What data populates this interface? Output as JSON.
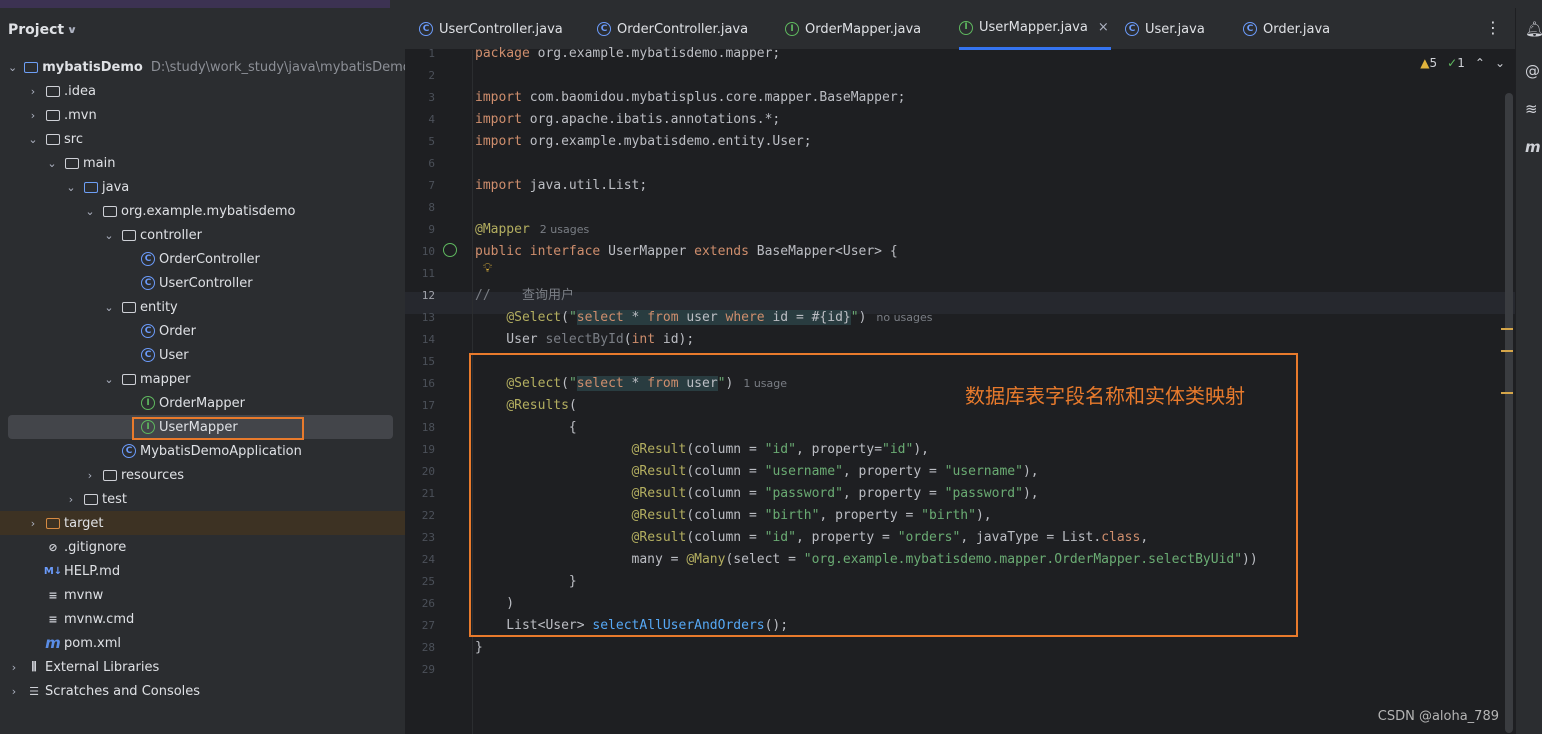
{
  "project_panel": {
    "title": "Project",
    "tree": [
      {
        "label": "mybatisDemo",
        "path": "D:\\study\\work_study\\java\\mybatisDemo",
        "icon": "module-folder-icon",
        "arrow": "expanded",
        "bold": true
      },
      {
        "label": ".idea",
        "icon": "folder-icon",
        "arrow": "collapsed"
      },
      {
        "label": ".mvn",
        "icon": "folder-icon",
        "arrow": "collapsed"
      },
      {
        "label": "src",
        "icon": "folder-icon",
        "arrow": "expanded"
      },
      {
        "label": "main",
        "icon": "folder-icon",
        "arrow": "expanded"
      },
      {
        "label": "java",
        "icon": "source-folder-icon",
        "arrow": "expanded"
      },
      {
        "label": "org.example.mybatisdemo",
        "icon": "package-icon",
        "arrow": "expanded"
      },
      {
        "label": "controller",
        "icon": "package-icon",
        "arrow": "expanded"
      },
      {
        "label": "OrderController",
        "icon": "class-icon"
      },
      {
        "label": "UserController",
        "icon": "class-icon"
      },
      {
        "label": "entity",
        "icon": "package-icon",
        "arrow": "expanded"
      },
      {
        "label": "Order",
        "icon": "class-icon"
      },
      {
        "label": "User",
        "icon": "class-icon"
      },
      {
        "label": "mapper",
        "icon": "package-icon",
        "arrow": "expanded"
      },
      {
        "label": "OrderMapper",
        "icon": "interface-icon"
      },
      {
        "label": "UserMapper",
        "icon": "interface-icon"
      },
      {
        "label": "MybatisDemoApplication",
        "icon": "spring-class-icon"
      },
      {
        "label": "resources",
        "icon": "resources-folder-icon",
        "arrow": "collapsed"
      },
      {
        "label": "test",
        "icon": "folder-icon",
        "arrow": "collapsed"
      },
      {
        "label": "target",
        "icon": "excluded-folder-icon",
        "arrow": "collapsed"
      },
      {
        "label": ".gitignore",
        "icon": "ignore-file-icon"
      },
      {
        "label": "HELP.md",
        "icon": "markdown-file-icon",
        "icon_text": "M↓"
      },
      {
        "label": "mvnw",
        "icon": "text-file-icon"
      },
      {
        "label": "mvnw.cmd",
        "icon": "text-file-icon"
      },
      {
        "label": "pom.xml",
        "icon": "maven-icon",
        "icon_text": "m"
      },
      {
        "label": "External Libraries",
        "icon": "libraries-icon",
        "arrow": "collapsed"
      },
      {
        "label": "Scratches and Consoles",
        "icon": "scratches-icon",
        "arrow": "collapsed"
      }
    ]
  },
  "tabs": [
    {
      "label": "UserController.java",
      "kind": "class"
    },
    {
      "label": "OrderController.java",
      "kind": "class"
    },
    {
      "label": "OrderMapper.java",
      "kind": "interface"
    },
    {
      "label": "UserMapper.java",
      "kind": "interface",
      "active": true,
      "close": "×"
    },
    {
      "label": "User.java",
      "kind": "class"
    },
    {
      "label": "Order.java",
      "kind": "class"
    }
  ],
  "tab_more": "⋮",
  "inspections": {
    "warnings": "5",
    "ok": "1"
  },
  "code_lines": [
    {
      "n": "1",
      "segs": [
        {
          "t": "package ",
          "c": "kw"
        },
        {
          "t": "org.example.mybatisdemo.mapper;"
        }
      ]
    },
    {
      "n": "2",
      "segs": []
    },
    {
      "n": "3",
      "segs": [
        {
          "t": "import ",
          "c": "kw"
        },
        {
          "t": "com.baomidou.mybatisplus.core.mapper.BaseMapper;"
        }
      ]
    },
    {
      "n": "4",
      "segs": [
        {
          "t": "import ",
          "c": "kw"
        },
        {
          "t": "org.apache.ibatis.annotations.*;"
        }
      ]
    },
    {
      "n": "5",
      "segs": [
        {
          "t": "import ",
          "c": "kw"
        },
        {
          "t": "org.example.mybatisdemo.entity.User;"
        }
      ]
    },
    {
      "n": "6",
      "segs": []
    },
    {
      "n": "7",
      "segs": [
        {
          "t": "import ",
          "c": "kw"
        },
        {
          "t": "java.util.List;"
        }
      ]
    },
    {
      "n": "8",
      "segs": []
    },
    {
      "n": "9",
      "segs": [
        {
          "t": "@Mapper",
          "c": "ann"
        },
        {
          "t": "2 usages",
          "c": "hint"
        }
      ]
    },
    {
      "n": "10",
      "segs": [
        {
          "t": "public interface ",
          "c": "kw"
        },
        {
          "t": "UserMapper "
        },
        {
          "t": "extends ",
          "c": "kw"
        },
        {
          "t": "BaseMapper<User> {"
        }
      ]
    },
    {
      "n": "11",
      "segs": []
    },
    {
      "n": "12",
      "segs": [
        {
          "t": "//    查询用户",
          "c": "cmt"
        }
      ]
    },
    {
      "n": "13",
      "segs": [
        {
          "t": "    "
        },
        {
          "t": "@Select",
          "c": "ann"
        },
        {
          "t": "("
        },
        {
          "t": "\"",
          "c": "str"
        },
        {
          "t": "select",
          "c": "sqlkw"
        },
        {
          "t": " * ",
          "c": "sql"
        },
        {
          "t": "from",
          "c": "sqlkw"
        },
        {
          "t": " user ",
          "c": "sql"
        },
        {
          "t": "where",
          "c": "sqlkw"
        },
        {
          "t": " id = #{id}",
          "c": "sql"
        },
        {
          "t": "\"",
          "c": "str"
        },
        {
          "t": ")"
        },
        {
          "t": "no usages",
          "c": "hint"
        }
      ]
    },
    {
      "n": "14",
      "segs": [
        {
          "t": "    User "
        },
        {
          "t": "selectById",
          "c": "cmt"
        },
        {
          "t": "("
        },
        {
          "t": "int ",
          "c": "kw"
        },
        {
          "t": "id);"
        }
      ]
    },
    {
      "n": "15",
      "segs": []
    },
    {
      "n": "16",
      "segs": [
        {
          "t": "    "
        },
        {
          "t": "@Select",
          "c": "ann"
        },
        {
          "t": "("
        },
        {
          "t": "\"",
          "c": "str"
        },
        {
          "t": "select",
          "c": "sqlkw"
        },
        {
          "t": " * ",
          "c": "sql"
        },
        {
          "t": "from",
          "c": "sqlkw"
        },
        {
          "t": " user",
          "c": "sql"
        },
        {
          "t": "\"",
          "c": "str"
        },
        {
          "t": ")"
        },
        {
          "t": "1 usage",
          "c": "hint"
        }
      ]
    },
    {
      "n": "17",
      "segs": [
        {
          "t": "    "
        },
        {
          "t": "@Results",
          "c": "ann"
        },
        {
          "t": "("
        }
      ]
    },
    {
      "n": "18",
      "segs": [
        {
          "t": "            {"
        }
      ]
    },
    {
      "n": "19",
      "segs": [
        {
          "t": "                    "
        },
        {
          "t": "@Result",
          "c": "ann"
        },
        {
          "t": "(column = "
        },
        {
          "t": "\"id\"",
          "c": "str"
        },
        {
          "t": ", property="
        },
        {
          "t": "\"id\"",
          "c": "str"
        },
        {
          "t": "),"
        }
      ]
    },
    {
      "n": "20",
      "segs": [
        {
          "t": "                    "
        },
        {
          "t": "@Result",
          "c": "ann"
        },
        {
          "t": "(column = "
        },
        {
          "t": "\"username\"",
          "c": "str"
        },
        {
          "t": ", property = "
        },
        {
          "t": "\"username\"",
          "c": "str"
        },
        {
          "t": "),"
        }
      ]
    },
    {
      "n": "21",
      "segs": [
        {
          "t": "                    "
        },
        {
          "t": "@Result",
          "c": "ann"
        },
        {
          "t": "(column = "
        },
        {
          "t": "\"password\"",
          "c": "str"
        },
        {
          "t": ", property = "
        },
        {
          "t": "\"password\"",
          "c": "str"
        },
        {
          "t": "),"
        }
      ]
    },
    {
      "n": "22",
      "segs": [
        {
          "t": "                    "
        },
        {
          "t": "@Result",
          "c": "ann"
        },
        {
          "t": "(column = "
        },
        {
          "t": "\"birth\"",
          "c": "str"
        },
        {
          "t": ", property = "
        },
        {
          "t": "\"birth\"",
          "c": "str"
        },
        {
          "t": "),"
        }
      ]
    },
    {
      "n": "23",
      "segs": [
        {
          "t": "                    "
        },
        {
          "t": "@Result",
          "c": "ann"
        },
        {
          "t": "(column = "
        },
        {
          "t": "\"id\"",
          "c": "str"
        },
        {
          "t": ", property = "
        },
        {
          "t": "\"orders\"",
          "c": "str"
        },
        {
          "t": ", javaType = List."
        },
        {
          "t": "class",
          "c": "kw"
        },
        {
          "t": ","
        }
      ]
    },
    {
      "n": "24",
      "segs": [
        {
          "t": "                    many = "
        },
        {
          "t": "@Many",
          "c": "ann"
        },
        {
          "t": "(select = "
        },
        {
          "t": "\"org.example.mybatisdemo.mapper.OrderMapper.selectByUid\"",
          "c": "str"
        },
        {
          "t": "))"
        }
      ]
    },
    {
      "n": "25",
      "segs": [
        {
          "t": "            }"
        }
      ]
    },
    {
      "n": "26",
      "segs": [
        {
          "t": "    )"
        }
      ]
    },
    {
      "n": "27",
      "segs": [
        {
          "t": "    List<User> "
        },
        {
          "t": "selectAllUserAndOrders",
          "c": "fn"
        },
        {
          "t": "();"
        }
      ]
    },
    {
      "n": "28",
      "segs": [
        {
          "t": "}"
        }
      ]
    },
    {
      "n": "29",
      "segs": []
    }
  ],
  "current_line": "12",
  "annotation_note": "数据库表字段名称和实体类映射",
  "watermark": "CSDN @aloha_789",
  "right_toolbar": [
    "notifications-icon",
    "ai-assistant-icon",
    "database-icon",
    "maven-icon"
  ],
  "colors": {
    "highlight_box": "#e87a2c",
    "accent": "#3574f0"
  }
}
